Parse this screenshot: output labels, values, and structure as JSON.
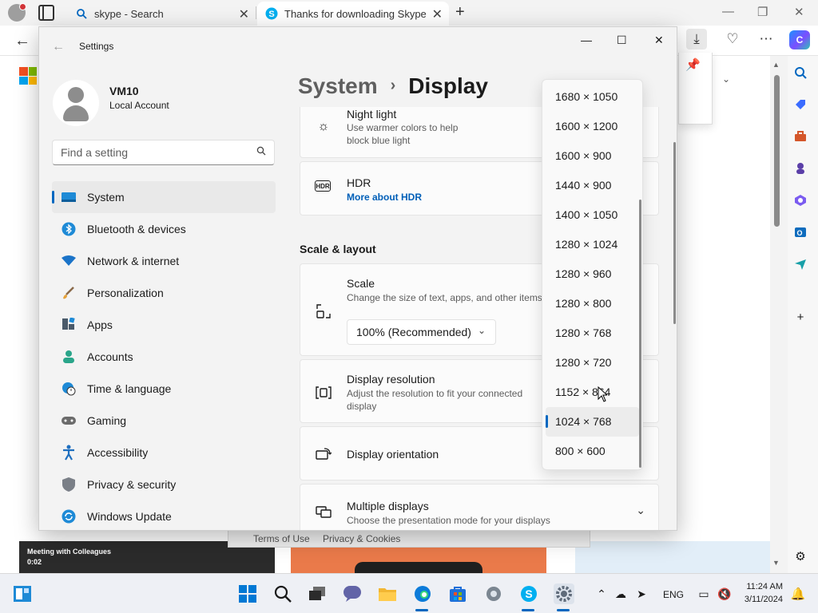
{
  "browser": {
    "tabs": [
      {
        "label": "skype - Search",
        "icon": "search-icon"
      },
      {
        "label": "Thanks for downloading Skype",
        "icon": "skype-icon"
      }
    ],
    "background_page": {
      "meeting_title": "Meeting with Colleagues",
      "meeting_time": "0:02",
      "footer_links": [
        "Terms of Use",
        "Privacy & Cookies"
      ]
    }
  },
  "settings": {
    "window_title": "Settings",
    "user": {
      "name": "VM10",
      "account_type": "Local Account"
    },
    "search": {
      "placeholder": "Find a setting"
    },
    "nav": [
      {
        "label": "System",
        "icon": "monitor-icon",
        "active": true
      },
      {
        "label": "Bluetooth & devices",
        "icon": "bluetooth-icon"
      },
      {
        "label": "Network & internet",
        "icon": "wifi-icon"
      },
      {
        "label": "Personalization",
        "icon": "brush-icon"
      },
      {
        "label": "Apps",
        "icon": "apps-icon"
      },
      {
        "label": "Accounts",
        "icon": "person-icon"
      },
      {
        "label": "Time & language",
        "icon": "globe-clock-icon"
      },
      {
        "label": "Gaming",
        "icon": "gamepad-icon"
      },
      {
        "label": "Accessibility",
        "icon": "accessibility-icon"
      },
      {
        "label": "Privacy & security",
        "icon": "shield-icon"
      },
      {
        "label": "Windows Update",
        "icon": "update-icon"
      }
    ],
    "breadcrumb": {
      "parent": "System",
      "separator": "›",
      "current": "Display"
    },
    "night_light": {
      "title": "Night light",
      "desc": "Use warmer colors to help block blue light"
    },
    "hdr": {
      "title": "HDR",
      "link": "More about HDR"
    },
    "section_scale_layout": "Scale & layout",
    "scale": {
      "title": "Scale",
      "desc": "Change the size of text, apps, and other items",
      "value": "100% (Recommended)"
    },
    "display_resolution": {
      "title": "Display resolution",
      "desc": "Adjust the resolution to fit your connected display"
    },
    "display_orientation": {
      "title": "Display orientation"
    },
    "multiple_displays": {
      "title": "Multiple displays",
      "desc": "Choose the presentation mode for your displays"
    },
    "resolution_options": [
      "1680 × 1050",
      "1600 × 1200",
      "1600 × 900",
      "1440 × 900",
      "1400 × 1050",
      "1280 × 1024",
      "1280 × 960",
      "1280 × 800",
      "1280 × 768",
      "1280 × 720",
      "1152 × 864",
      "1024 × 768",
      "800 × 600"
    ],
    "selected_resolution": "1024 × 768"
  },
  "taskbar": {
    "language": "ENG",
    "time": "11:24 AM",
    "date": "3/11/2024"
  },
  "colors": {
    "accent": "#0067c0",
    "link": "#005fb8"
  }
}
